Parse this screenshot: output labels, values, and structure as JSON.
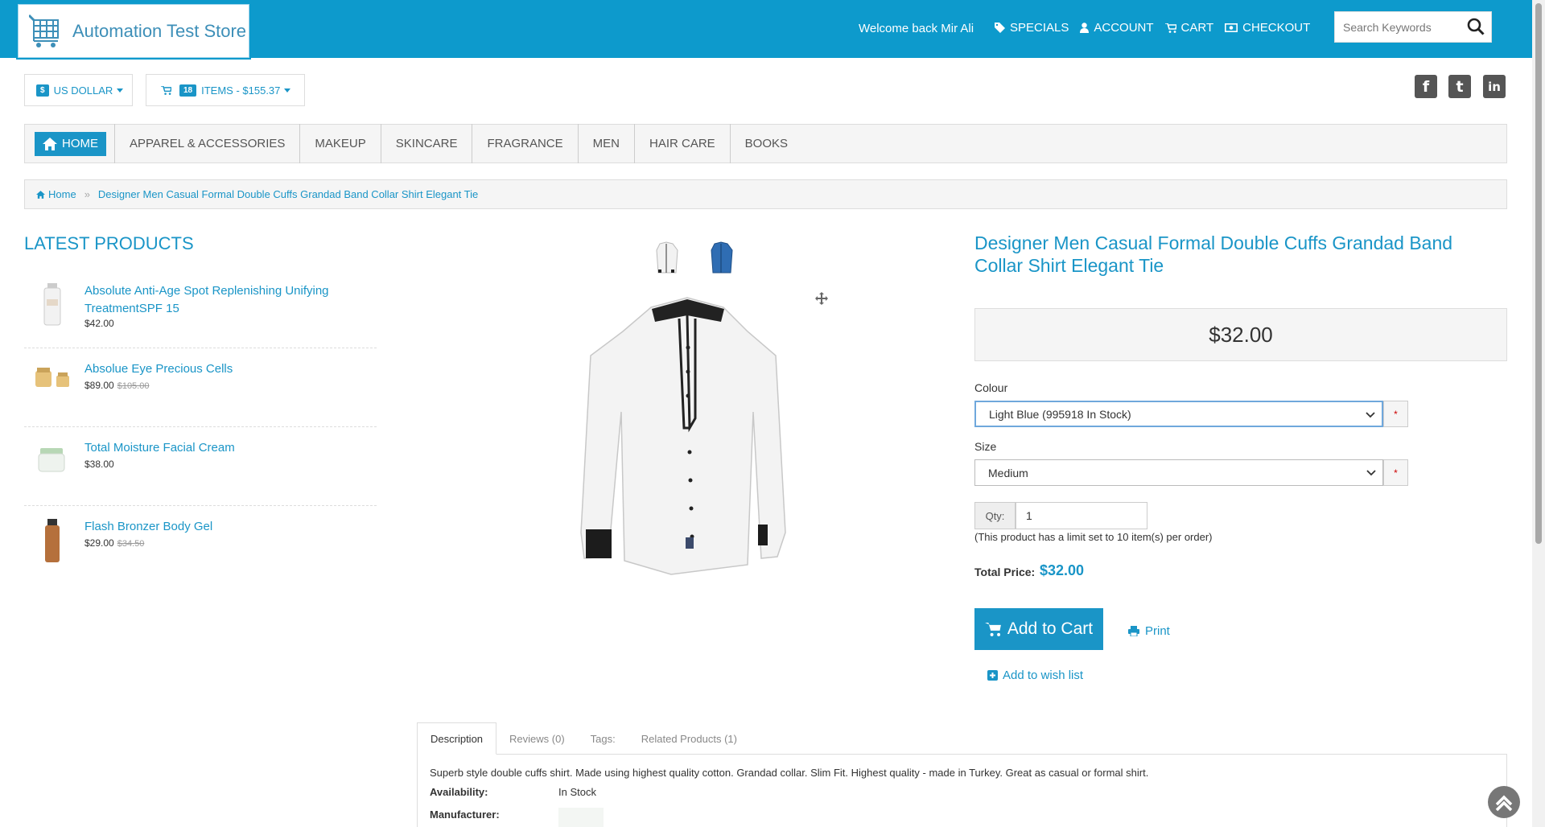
{
  "header": {
    "logo_text": "Automation Test Store",
    "welcome": "Welcome back Mir Ali",
    "nav": [
      {
        "label": "SPECIALS",
        "icon": "tag-icon"
      },
      {
        "label": "ACCOUNT",
        "icon": "user-icon"
      },
      {
        "label": "CART",
        "icon": "cart-icon"
      },
      {
        "label": "CHECKOUT",
        "icon": "money-icon"
      }
    ],
    "search_placeholder": "Search Keywords"
  },
  "currency": {
    "symbol": "$",
    "label": "US DOLLAR"
  },
  "cart_summary": {
    "count": "18",
    "label": "ITEMS - $155.37"
  },
  "social": [
    "f",
    "t",
    "in"
  ],
  "categories": {
    "home": "HOME",
    "items": [
      "APPAREL & ACCESSORIES",
      "MAKEUP",
      "SKINCARE",
      "FRAGRANCE",
      "MEN",
      "HAIR CARE",
      "BOOKS"
    ]
  },
  "breadcrumb": {
    "home": "Home",
    "current": "Designer Men Casual Formal Double Cuffs Grandad Band Collar Shirt Elegant Tie"
  },
  "latest": {
    "title": "LATEST PRODUCTS",
    "items": [
      {
        "name": "Absolute Anti-Age Spot Replenishing Unifying TreatmentSPF 15",
        "price": "$42.00",
        "old": ""
      },
      {
        "name": "Absolue Eye Precious Cells",
        "price": "$89.00",
        "old": "$105.00"
      },
      {
        "name": "Total Moisture Facial Cream",
        "price": "$38.00",
        "old": ""
      },
      {
        "name": "Flash Bronzer Body Gel",
        "price": "$29.00",
        "old": "$34.50"
      }
    ]
  },
  "product": {
    "title": "Designer Men Casual Formal Double Cuffs Grandad Band Collar Shirt Elegant Tie",
    "price": "$32.00",
    "colour_label": "Colour",
    "colour_value": "Light Blue (995918 In Stock)",
    "size_label": "Size",
    "size_value": "Medium",
    "required_mark": "*",
    "qty_label": "Qty:",
    "qty_value": "1",
    "limit_note": "(This product has a limit set to 10 item(s) per order)",
    "total_label": "Total Price:",
    "total_value": "$32.00",
    "add_to_cart": "Add to Cart",
    "print": "Print",
    "wishlist": "Add to wish list"
  },
  "tabs": {
    "items": [
      "Description",
      "Reviews (0)",
      "Tags:",
      "Related Products (1)"
    ],
    "description": "Superb style double cuffs shirt. Made using highest quality cotton. Grandad collar. Slim Fit. Highest quality - made in Turkey. Great as casual or formal shirt.",
    "availability_label": "Availability:",
    "availability_value": "In Stock",
    "manufacturer_label": "Manufacturer:"
  },
  "colors": {
    "brand": "#0d9acc",
    "link": "#1a95c7"
  }
}
